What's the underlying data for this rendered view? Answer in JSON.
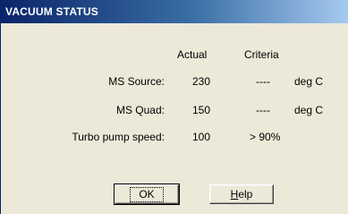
{
  "window": {
    "title": "VACUUM STATUS"
  },
  "headers": {
    "actual": "Actual",
    "criteria": "Criteria"
  },
  "rows": [
    {
      "label": "MS Source:",
      "actual": "230",
      "criteria": "----",
      "unit": "deg C"
    },
    {
      "label": "MS Quad:",
      "actual": "150",
      "criteria": "----",
      "unit": "deg C"
    },
    {
      "label": "Turbo pump speed:",
      "actual": "100",
      "criteria": "> 90%",
      "unit": ""
    }
  ],
  "buttons": {
    "ok": "OK",
    "help_mnemonic": "H",
    "help_rest": "elp"
  }
}
